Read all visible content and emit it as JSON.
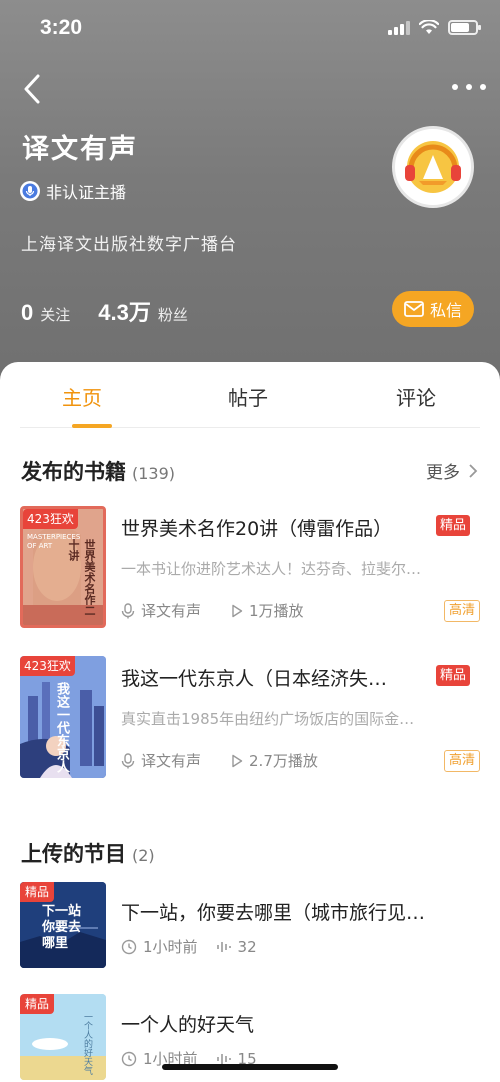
{
  "status_bar": {
    "time": "3:20"
  },
  "profile": {
    "name": "译文有声",
    "badge": "非认证主播",
    "description": "上海译文出版社数字广播台",
    "following_count": "0",
    "following_label": "关注",
    "followers_count": "4.3万",
    "followers_label": "粉丝",
    "message_button": "私信"
  },
  "tabs": [
    {
      "label": "主页",
      "active": true
    },
    {
      "label": "帖子",
      "active": false
    },
    {
      "label": "评论",
      "active": false
    }
  ],
  "books_section": {
    "title": "发布的书籍",
    "count": "(139)",
    "more": "更多"
  },
  "books": [
    {
      "promo": "423狂欢",
      "cover_text": "世界美术名作二十讲",
      "cover_en": "MASTERPIECES OF ART",
      "title": "世界美术名作20讲（傅雷作品）",
      "badge": "精品",
      "subtitle": "一本书让你进阶艺术达人！达芬奇、拉斐尔…",
      "author": "译文有声",
      "plays": "1万播放",
      "quality": "高清"
    },
    {
      "promo": "423狂欢",
      "cover_text": "我这一代东京人",
      "title": "我这一代东京人（日本经济失…",
      "badge": "精品",
      "subtitle": "真实直击1985年由纽约广场饭店的国际金…",
      "author": "译文有声",
      "plays": "2.7万播放",
      "quality": "高清"
    }
  ],
  "programs_section": {
    "title": "上传的节目",
    "count": "(2)"
  },
  "programs": [
    {
      "tag": "精品",
      "cover_text": "下一站你要去哪里",
      "title": "下一站，你要去哪里（城市旅行见…",
      "time": "1小时前",
      "plays": "32"
    },
    {
      "tag": "精品",
      "cover_text": "一个人的好天气",
      "title": "一个人的好天气",
      "time": "1小时前",
      "plays": "15"
    }
  ],
  "colors": {
    "accent": "#f5a623",
    "red_badge": "#e8443a",
    "header_bg": "#7a7a7a"
  }
}
